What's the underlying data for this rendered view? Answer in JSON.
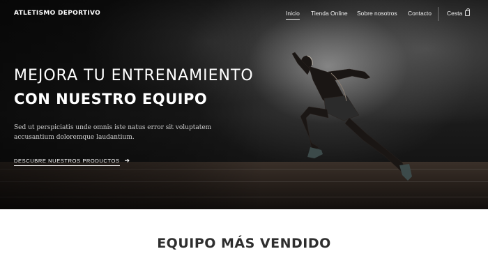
{
  "brand": {
    "name": "ATLETISMO DEPORTIVO"
  },
  "nav": {
    "items": [
      {
        "label": "Inicio",
        "active": true
      },
      {
        "label": "Tienda Online",
        "active": false
      },
      {
        "label": "Sobre nosotros",
        "active": false
      },
      {
        "label": "Contacto",
        "active": false
      }
    ],
    "cart_label": "Cesta",
    "cart_icon": "shopping-bag-icon"
  },
  "hero": {
    "headline_line1": "MEJORA TU ENTRENAMIENTO",
    "headline_line2": "CON NUESTRO EQUIPO",
    "body_text": "Sed ut perspiciatis unde omnis iste natus error sit voluptatem accusantium doloremque laudantium.",
    "cta_label": "DESCUBRE NUESTROS PRODUCTOS",
    "cta_icon": "arrow-right-icon",
    "image": "sprinter-on-track-photo"
  },
  "section": {
    "title": "EQUIPO MÁS VENDIDO"
  }
}
